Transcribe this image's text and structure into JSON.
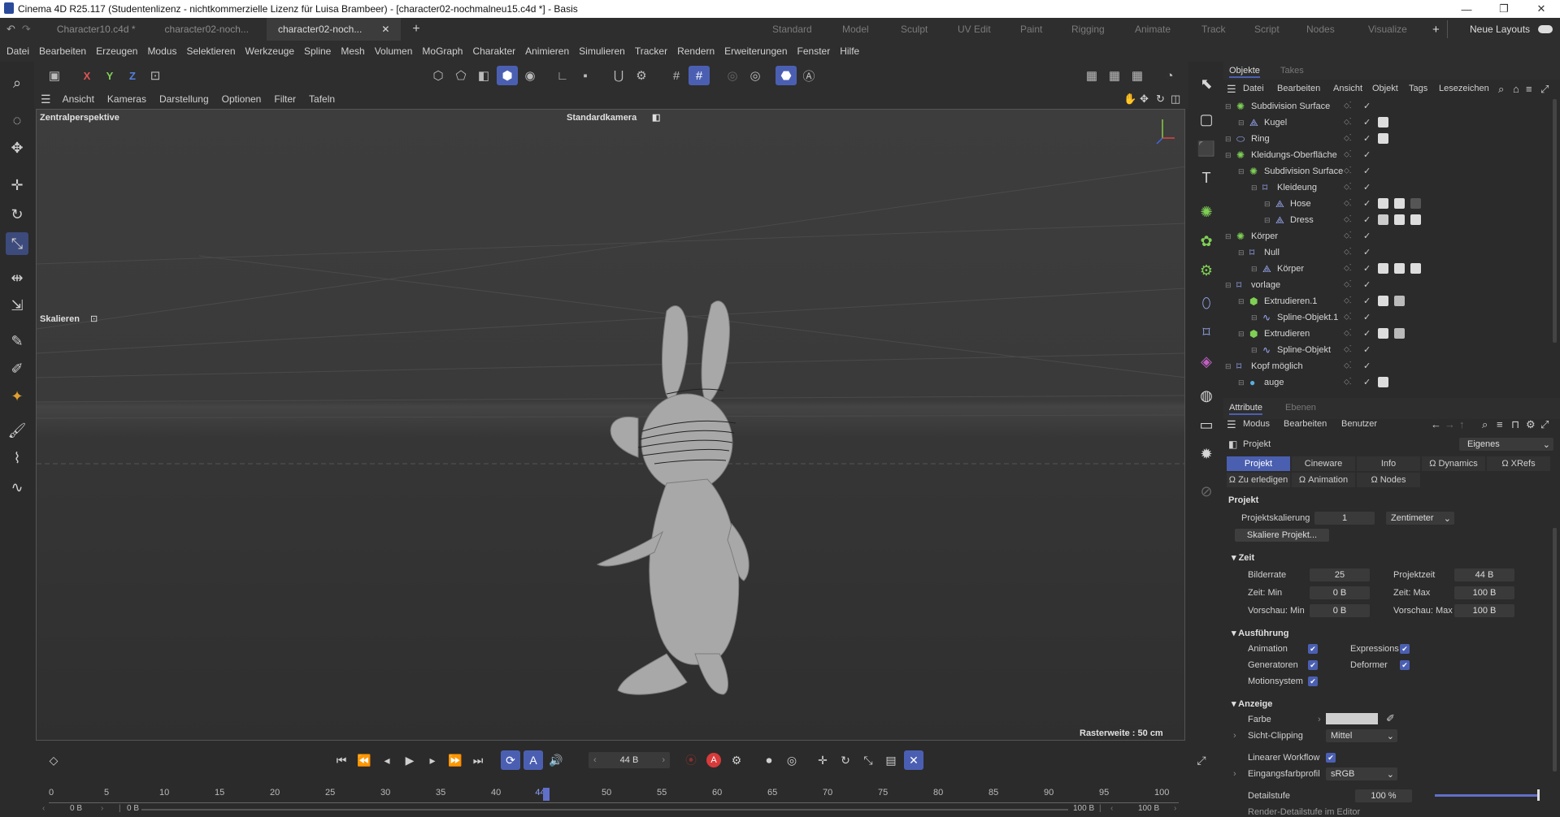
{
  "window": {
    "title": "Cinema 4D R25.117 (Studentenlizenz - nichtkommerzielle Lizenz für Luisa Brambeer) - [character02-nochmalneu15.c4d *] - Basis"
  },
  "doc_tabs": [
    "Character10.c4d *",
    "character02-noch...",
    "character02-noch..."
  ],
  "layouts": [
    "Standard",
    "Model",
    "Sculpt",
    "UV Edit",
    "Paint",
    "Rigging",
    "Animate",
    "Track",
    "Script",
    "Nodes",
    "Visualize"
  ],
  "layout_menu": "Neue Layouts",
  "menu": [
    "Datei",
    "Bearbeiten",
    "Erzeugen",
    "Modus",
    "Selektieren",
    "Werkzeuge",
    "Spline",
    "Mesh",
    "Volumen",
    "MoGraph",
    "Charakter",
    "Animieren",
    "Simulieren",
    "Tracker",
    "Rendern",
    "Erweiterungen",
    "Fenster",
    "Hilfe"
  ],
  "axes": [
    "X",
    "Y",
    "Z"
  ],
  "viewport_menu": [
    "Ansicht",
    "Kameras",
    "Darstellung",
    "Optionen",
    "Filter",
    "Tafeln"
  ],
  "viewport": {
    "perspective": "Zentralperspektive",
    "camera": "Standardkamera",
    "tool_label": "Skalieren",
    "grid": "Rasterweite : 50 cm"
  },
  "timeline": {
    "current_frame": "44 B",
    "ruler": [
      "0",
      "5",
      "10",
      "15",
      "20",
      "25",
      "30",
      "35",
      "40",
      "44",
      "50",
      "55",
      "60",
      "65",
      "70",
      "75",
      "80",
      "85",
      "90",
      "95",
      "100"
    ],
    "start": "0 B",
    "start2": "0 B",
    "end": "100 B",
    "end2": "100 B"
  },
  "objects_panel": {
    "tabs": [
      "Objekte",
      "Takes"
    ],
    "menu": [
      "Datei",
      "Bearbeiten",
      "Ansicht",
      "Objekt",
      "Tags",
      "Lesezeichen"
    ],
    "items": [
      {
        "name": "Subdivision Surface",
        "indent": 0
      },
      {
        "name": "Kugel",
        "indent": 1
      },
      {
        "name": "Ring",
        "indent": 0
      },
      {
        "name": "Kleidungs-Oberfläche",
        "indent": 0
      },
      {
        "name": "Subdivision Surface",
        "indent": 1
      },
      {
        "name": "Kleideung",
        "indent": 2
      },
      {
        "name": "Hose",
        "indent": 3
      },
      {
        "name": "Dress",
        "indent": 3
      },
      {
        "name": "Körper",
        "indent": 0
      },
      {
        "name": "Null",
        "indent": 1
      },
      {
        "name": "Körper",
        "indent": 2
      },
      {
        "name": "vorlage",
        "indent": 0
      },
      {
        "name": "Extrudieren.1",
        "indent": 1
      },
      {
        "name": "Spline-Objekt.1",
        "indent": 2
      },
      {
        "name": "Extrudieren",
        "indent": 1
      },
      {
        "name": "Spline-Objekt",
        "indent": 2
      },
      {
        "name": "Kopf möglich",
        "indent": 0
      },
      {
        "name": "auge",
        "indent": 1
      }
    ]
  },
  "attributes": {
    "tabs": [
      "Attribute",
      "Ebenen"
    ],
    "menu": [
      "Modus",
      "Bearbeiten",
      "Benutzer"
    ],
    "object": "Projekt",
    "preset": "Eigenes",
    "subtabs": [
      "Projekt",
      "Cineware",
      "Info",
      "Dynamics",
      "XRefs"
    ],
    "subtabs2": [
      "Zu erledigen",
      "Animation",
      "Nodes"
    ],
    "section": "Projekt",
    "projektskalierung_label": "Projektskalierung",
    "projektskalierung": "1",
    "unit": "Zentimeter",
    "scale_button": "Skaliere Projekt...",
    "zeit": "Zeit",
    "bilderrate_label": "Bilderrate",
    "bilderrate": "25",
    "projektzeit_label": "Projektzeit",
    "projektzeit": "44 B",
    "zeitmin_label": "Zeit: Min",
    "zeitmin": "0 B",
    "zeitmax_label": "Zeit: Max",
    "zeitmax": "100 B",
    "vormin_label": "Vorschau: Min",
    "vormin": "0 B",
    "vormax_label": "Vorschau: Max",
    "vormax": "100 B",
    "ausfuehrung": "Ausführung",
    "animation": "Animation",
    "expressions": "Expressions",
    "generatoren": "Generatoren",
    "deformer": "Deformer",
    "motionsystem": "Motionsystem",
    "anzeige": "Anzeige",
    "farbe": "Farbe",
    "sichtclipping_label": "Sicht-Clipping",
    "sichtclipping": "Mittel",
    "linear": "Linearer Workflow",
    "eingang_label": "Eingangsfarbprofil",
    "eingang": "sRGB",
    "detail_label": "Detailstufe",
    "detail": "100 %",
    "render_detail": "Render-Detailstufe im Editor"
  }
}
